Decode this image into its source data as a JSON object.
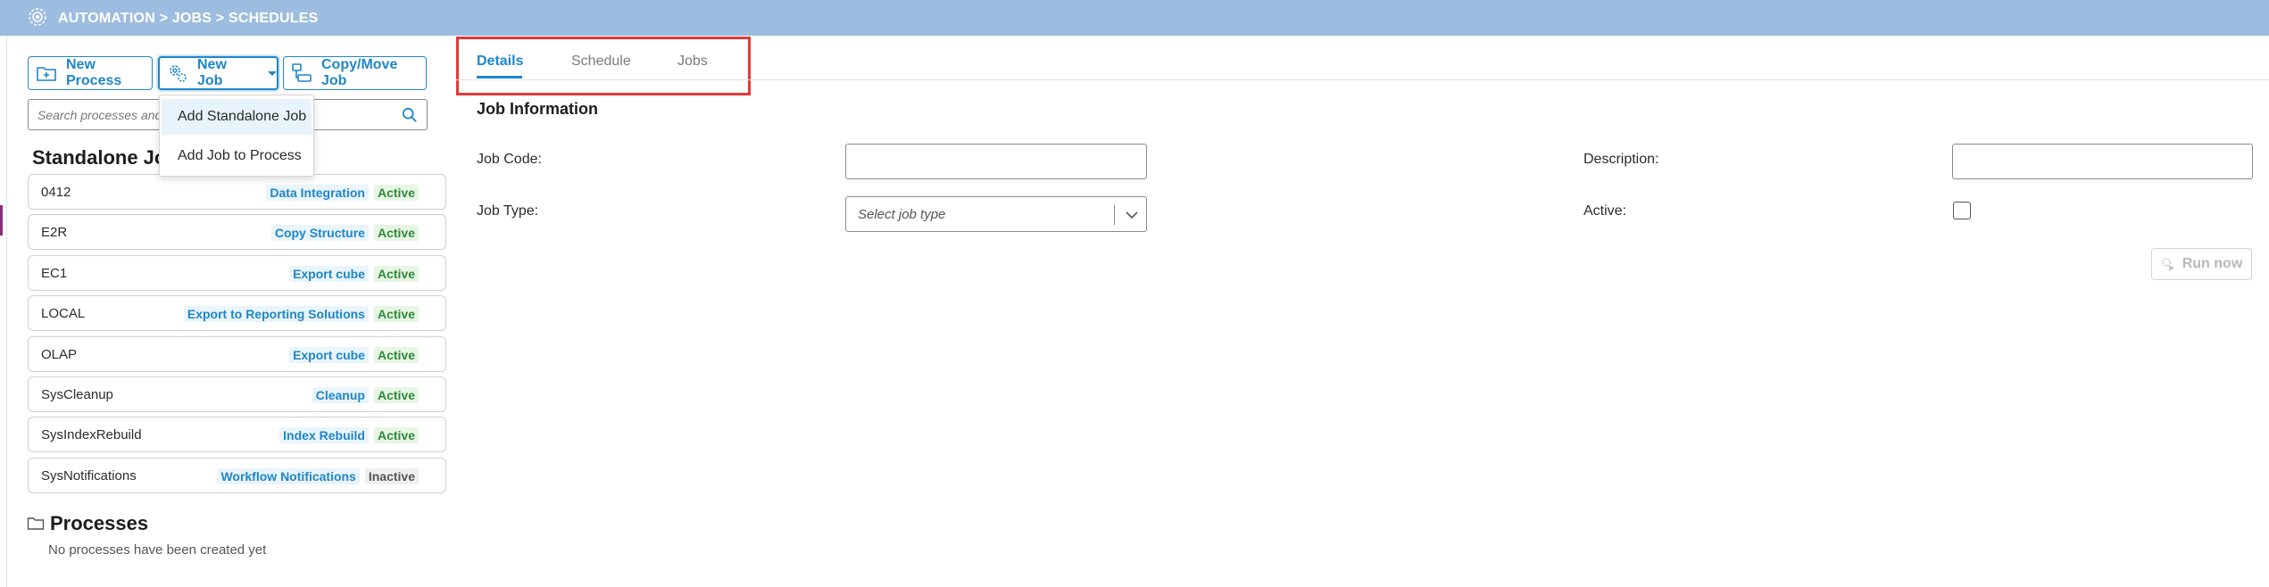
{
  "header": {
    "breadcrumb": "AUTOMATION > JOBS > SCHEDULES",
    "icon": "gear-cluster-icon",
    "color": "#9dbde0"
  },
  "toolbar": {
    "new_process_label": "New Process",
    "new_job_label": "New Job",
    "copy_move_label": "Copy/Move Job",
    "accent_color": "#1f86c8"
  },
  "search": {
    "placeholder": "Search processes and jobs"
  },
  "new_job_menu": {
    "items": [
      {
        "label": "Add Standalone Job"
      },
      {
        "label": "Add Job to Process"
      }
    ]
  },
  "standalone": {
    "title": "Standalone Jobs",
    "jobs": [
      {
        "code": "0412",
        "type": "Data Integration",
        "status": "Active"
      },
      {
        "code": "E2R",
        "type": "Copy Structure",
        "status": "Active"
      },
      {
        "code": "EC1",
        "type": "Export cube",
        "status": "Active"
      },
      {
        "code": "LOCAL",
        "type": "Export to Reporting Solutions",
        "status": "Active"
      },
      {
        "code": "OLAP",
        "type": "Export cube",
        "status": "Active"
      },
      {
        "code": "SysCleanup",
        "type": "Cleanup",
        "status": "Active"
      },
      {
        "code": "SysIndexRebuild",
        "type": "Index Rebuild",
        "status": "Active"
      },
      {
        "code": "SysNotifications",
        "type": "Workflow Notifications",
        "status": "Inactive"
      }
    ]
  },
  "processes": {
    "title": "Processes",
    "empty_text": "No processes have been created yet"
  },
  "tabs": [
    {
      "label": "Details",
      "active": true
    },
    {
      "label": "Schedule",
      "active": false
    },
    {
      "label": "Jobs",
      "active": false
    }
  ],
  "form": {
    "title": "Job Information",
    "job_code_label": "Job Code:",
    "job_code_value": "",
    "description_label": "Description:",
    "description_value": "",
    "job_type_label": "Job Type:",
    "job_type_placeholder": "Select job type",
    "active_label": "Active:",
    "active_checked": false,
    "run_now_label": "Run now"
  }
}
